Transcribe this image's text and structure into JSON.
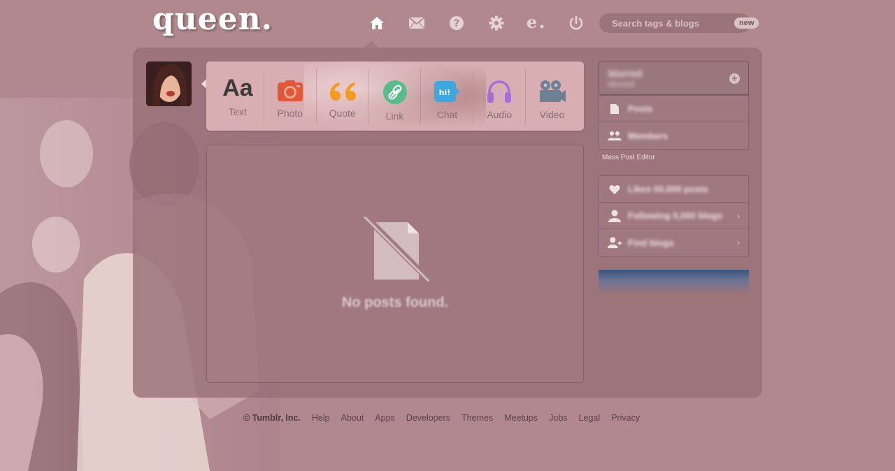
{
  "header": {
    "logo": "queen.",
    "nav": [
      {
        "name": "home",
        "icon": "home-icon"
      },
      {
        "name": "messages",
        "icon": "envelope-icon"
      },
      {
        "name": "help",
        "icon": "question-icon"
      },
      {
        "name": "settings",
        "icon": "gear-icon"
      },
      {
        "name": "edit",
        "icon": "e-logo-icon"
      },
      {
        "name": "logout",
        "icon": "power-icon"
      }
    ],
    "search": {
      "placeholder": "Search tags & blogs",
      "badge": "new"
    }
  },
  "post_types": [
    {
      "label": "Text",
      "icon": "text-aa-icon",
      "glyph": "Aa",
      "color": "#3f3a3a"
    },
    {
      "label": "Photo",
      "icon": "camera-icon",
      "color": "#e0583a"
    },
    {
      "label": "Quote",
      "icon": "quote-icon",
      "color": "#f39a22"
    },
    {
      "label": "Link",
      "icon": "link-icon",
      "color": "#56bc8a"
    },
    {
      "label": "Chat",
      "icon": "chat-icon",
      "glyph": "hi!",
      "color": "#3da8e0"
    },
    {
      "label": "Audio",
      "icon": "headphones-icon",
      "color": "#a76fd6"
    },
    {
      "label": "Video",
      "icon": "video-camera-icon",
      "color": "#6f7f94"
    }
  ],
  "feed": {
    "empty_text": "No posts found."
  },
  "sidebar": {
    "blog_name": "blurred",
    "blog_sub": "blurred",
    "blog_items": [
      {
        "label": "Posts",
        "icon": "document-icon"
      },
      {
        "label": "Members",
        "icon": "members-icon"
      }
    ],
    "mass_post": "Mass Post Editor",
    "account_items": [
      {
        "label": "Likes 00,000 posts",
        "icon": "heart-icon"
      },
      {
        "label": "Following 0,000 blogs",
        "icon": "person-icon",
        "arrow": "›"
      },
      {
        "label": "Find blogs",
        "icon": "add-person-icon",
        "arrow": "›"
      }
    ]
  },
  "footer": {
    "copyright": "© Tumblr, Inc.",
    "links": [
      "Help",
      "About",
      "Apps",
      "Developers",
      "Themes",
      "Meetups",
      "Jobs",
      "Legal",
      "Privacy"
    ]
  }
}
